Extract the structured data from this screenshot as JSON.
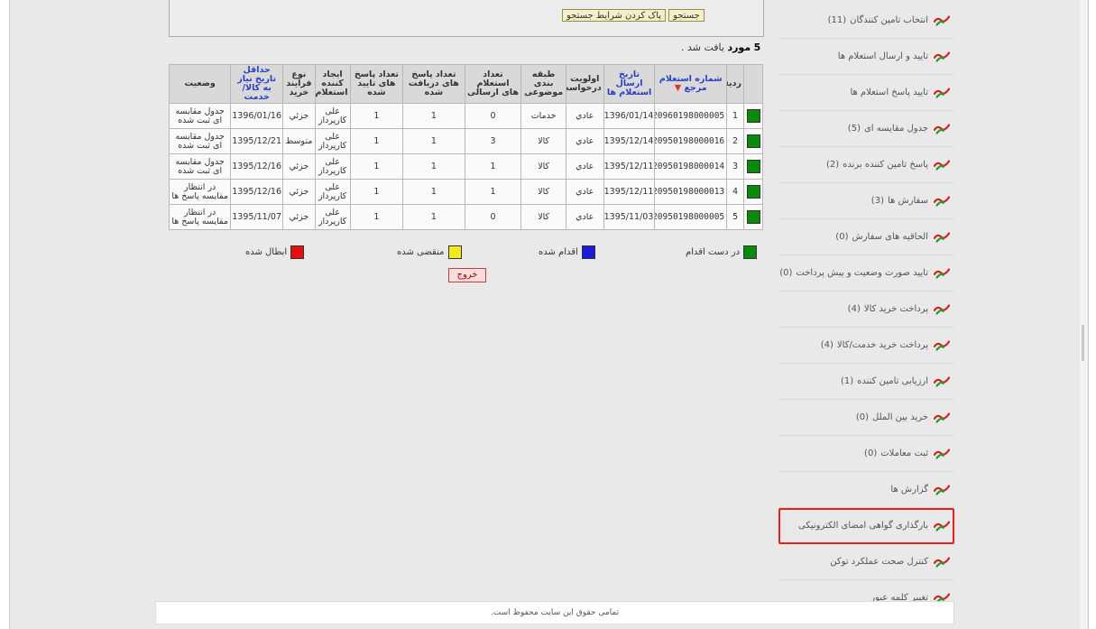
{
  "colors": {
    "accent_green": "#0a8a0a",
    "status_blue": "#1a1ad8",
    "status_yellow": "#f2ea20",
    "status_red": "#e21010",
    "active_outline": "#e02222"
  },
  "search": {
    "search_label": "جستجو",
    "clear_label": "پاک کردن شرایط جستجو"
  },
  "results": {
    "count": "5",
    "count_suffix": "مورد",
    "found_label": "یافت شد ."
  },
  "table": {
    "headers": {
      "row_no": "ردیف",
      "ref_no": "شماره استعلام مرجع",
      "send_date": "تاریخ ارسال استعلام ها",
      "priority": "اولویت درخواست",
      "category": "طبقه بندی موضوعی",
      "sent_count": "تعداد استعلام های ارسالی",
      "received_count": "تعداد پاسخ های دریافت شده",
      "approved_count": "تعداد پاسخ های تایید شده",
      "creator": "ایجاد کننده استعلام",
      "purchase_type": "نوع فرآیند خرید",
      "min_need_date": "حداقل تاریخ نیاز به کالا/ خدمت",
      "status": "وضعیت"
    },
    "rows": [
      {
        "no": "1",
        "ref": "20960198000005",
        "date": "1396/01/14",
        "priority": "عادي",
        "category": "خدمات",
        "sent": "0",
        "received": "1",
        "approved": "1",
        "creator": "علی کارپرداز",
        "type": "جزئي",
        "need": "1396/01/16",
        "status": "جدول مقایسه ای ثبت شده"
      },
      {
        "no": "2",
        "ref": "20950198000016",
        "date": "1395/12/14",
        "priority": "عادي",
        "category": "کالا",
        "sent": "3",
        "received": "1",
        "approved": "1",
        "creator": "علی کارپرداز",
        "type": "متوسط",
        "need": "1395/12/21",
        "status": "جدول مقایسه ای ثبت شده"
      },
      {
        "no": "3",
        "ref": "20950198000014",
        "date": "1395/12/11",
        "priority": "عادي",
        "category": "کالا",
        "sent": "1",
        "received": "1",
        "approved": "1",
        "creator": "علی کارپرداز",
        "type": "جزئي",
        "need": "1395/12/16",
        "status": "جدول مقایسه ای ثبت شده"
      },
      {
        "no": "4",
        "ref": "20950198000013",
        "date": "1395/12/11",
        "priority": "عادي",
        "category": "کالا",
        "sent": "1",
        "received": "1",
        "approved": "1",
        "creator": "علی کارپرداز",
        "type": "جزئي",
        "need": "1395/12/16",
        "status": "در انتظار مقایسه پاسخ ها"
      },
      {
        "no": "5",
        "ref": "20950198000005",
        "date": "1395/11/03",
        "priority": "عادي",
        "category": "کالا",
        "sent": "0",
        "received": "1",
        "approved": "1",
        "creator": "علی کارپرداز",
        "type": "جزئي",
        "need": "1395/11/07",
        "status": "در انتظار مقایسه پاسخ ها"
      }
    ]
  },
  "legend": {
    "in_progress": "در دست اقدام",
    "done": "اقدام شده",
    "expired": "منقضی شده",
    "cancelled": "ابطال شده"
  },
  "exit_label": "خروج",
  "sidebar": {
    "items": [
      {
        "label": "انتخاب تامین کنندگان",
        "count": "(11)"
      },
      {
        "label": "تایید و ارسال استعلام ها",
        "count": ""
      },
      {
        "label": "تایید پاسخ استعلام ها",
        "count": ""
      },
      {
        "label": "جدول مقایسه ای",
        "count": "(5)"
      },
      {
        "label": "پاسخ تامین کننده برنده",
        "count": "(2)"
      },
      {
        "label": "سفارش ها",
        "count": "(3)"
      },
      {
        "label": "الحاقیه های سفارش",
        "count": "(0)"
      },
      {
        "label": "تایید صورت وضعیت و پیش پرداخت",
        "count": "(0)"
      },
      {
        "label": "پرداخت خرید کالا",
        "count": "(4)"
      },
      {
        "label": "پرداخت خرید خدمت/کالا",
        "count": "(4)"
      },
      {
        "label": "ارزیابی تامین کننده",
        "count": "(1)"
      },
      {
        "label": "خرید بین الملل",
        "count": "(0)"
      },
      {
        "label": "ثبت معاملات",
        "count": "(0)"
      },
      {
        "label": "گزارش ها",
        "count": ""
      },
      {
        "label": "بارگذاری گواهی امضای الکترونیکی",
        "count": ""
      },
      {
        "label": "کنترل صحت عملکرد توکن",
        "count": ""
      },
      {
        "label": "تغییر کلمه عبور",
        "count": ""
      }
    ],
    "active_index": "14"
  },
  "footer": "تمامی حقوق این سایت محفوظ است."
}
